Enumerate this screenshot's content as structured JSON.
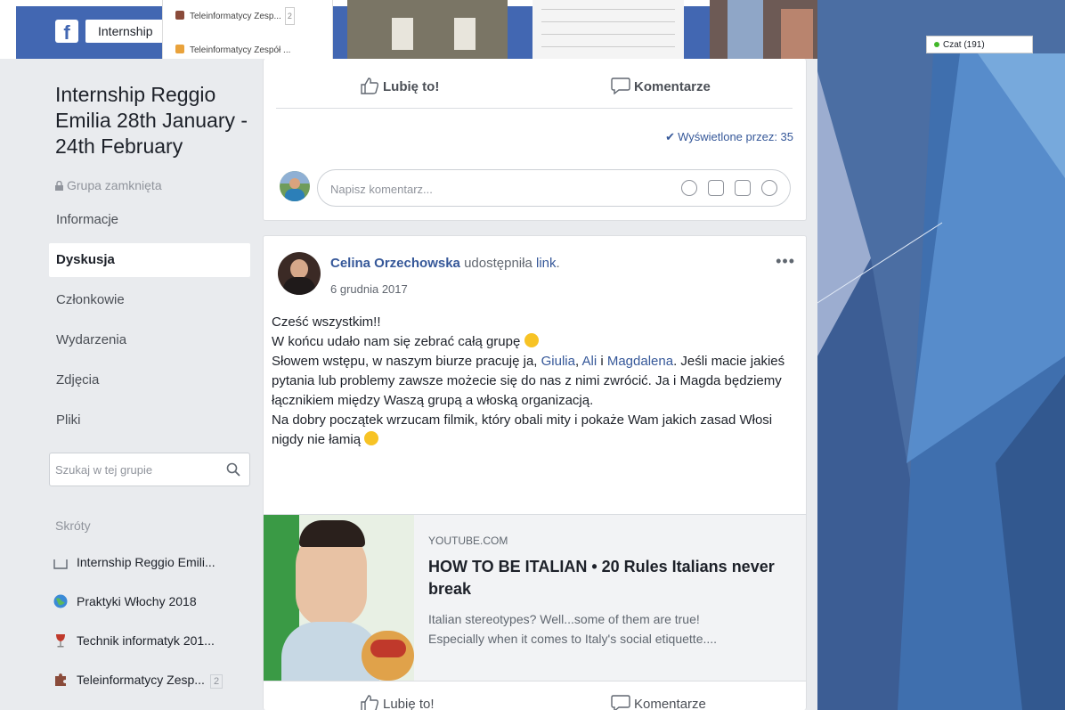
{
  "topbar": {
    "logo": "f",
    "search_value": "Internship",
    "dropdown_items": [
      {
        "label": "Teleinformatycy Zesp...",
        "badge": "2"
      },
      {
        "label": "Teleinformatycy Zespół ..."
      }
    ],
    "chat_label": "Czat (191)"
  },
  "group": {
    "title": "Internship Reggio Emilia 28th January - 24th February",
    "type": "Grupa zamknięta"
  },
  "nav": [
    {
      "label": "Informacje"
    },
    {
      "label": "Dyskusja"
    },
    {
      "label": "Członkowie"
    },
    {
      "label": "Wydarzenia"
    },
    {
      "label": "Zdjęcia"
    },
    {
      "label": "Pliki"
    }
  ],
  "group_search": {
    "placeholder": "Szukaj w tej grupie"
  },
  "shortcuts": {
    "heading": "Skróty",
    "items": [
      {
        "label": "Internship Reggio Emili...",
        "icon": "group-icon"
      },
      {
        "label": "Praktyki Włochy 2018",
        "icon": "globe-icon"
      },
      {
        "label": "Technik informatyk 201...",
        "icon": "wine-icon"
      },
      {
        "label": "Teleinformatycy Zesp...",
        "icon": "puzzle-icon",
        "badge": "2"
      }
    ]
  },
  "prev_post": {
    "like_label": "Lubię to!",
    "comment_label": "Komentarze",
    "seen_label": "Wyświetlone przez: 35",
    "comment_placeholder": "Napisz komentarz..."
  },
  "post": {
    "author": "Celina Orzechowska",
    "action": "udostępniła",
    "link_word": "link",
    "period": ".",
    "date": "6 grudnia 2017",
    "more": "•••",
    "lines": {
      "l1": "Cześć wszystkim!!",
      "l2": "W końcu udało nam się zebrać całą grupę",
      "l3a": "Słowem wstępu, w naszym biurze pracuję ja, ",
      "l3n1": "Giulia",
      "l3c1": ", ",
      "l3n2": "Ali",
      "l3c2": " i ",
      "l3n3": "Magdalena",
      "l3b": ". Jeśli macie jakieś pytania lub problemy zawsze możecie się do nas z nimi zwrócić. Ja i Magda będziemy łącznikiem między Waszą grupą a włoską organizacją.",
      "l4": "Na dobry początek wrzucam filmik, który obali mity i pokaże Wam jakich zasad Włosi nigdy nie łamią"
    },
    "link": {
      "domain": "YOUTUBE.COM",
      "title": "HOW TO BE ITALIAN • 20 Rules Italians never break",
      "desc1": "Italian stereotypes? Well...some of them are true!",
      "desc2": "Especially when it comes to Italy's social etiquette...."
    },
    "like_label": "Lubię to!",
    "comment_label": "Komentarze"
  }
}
